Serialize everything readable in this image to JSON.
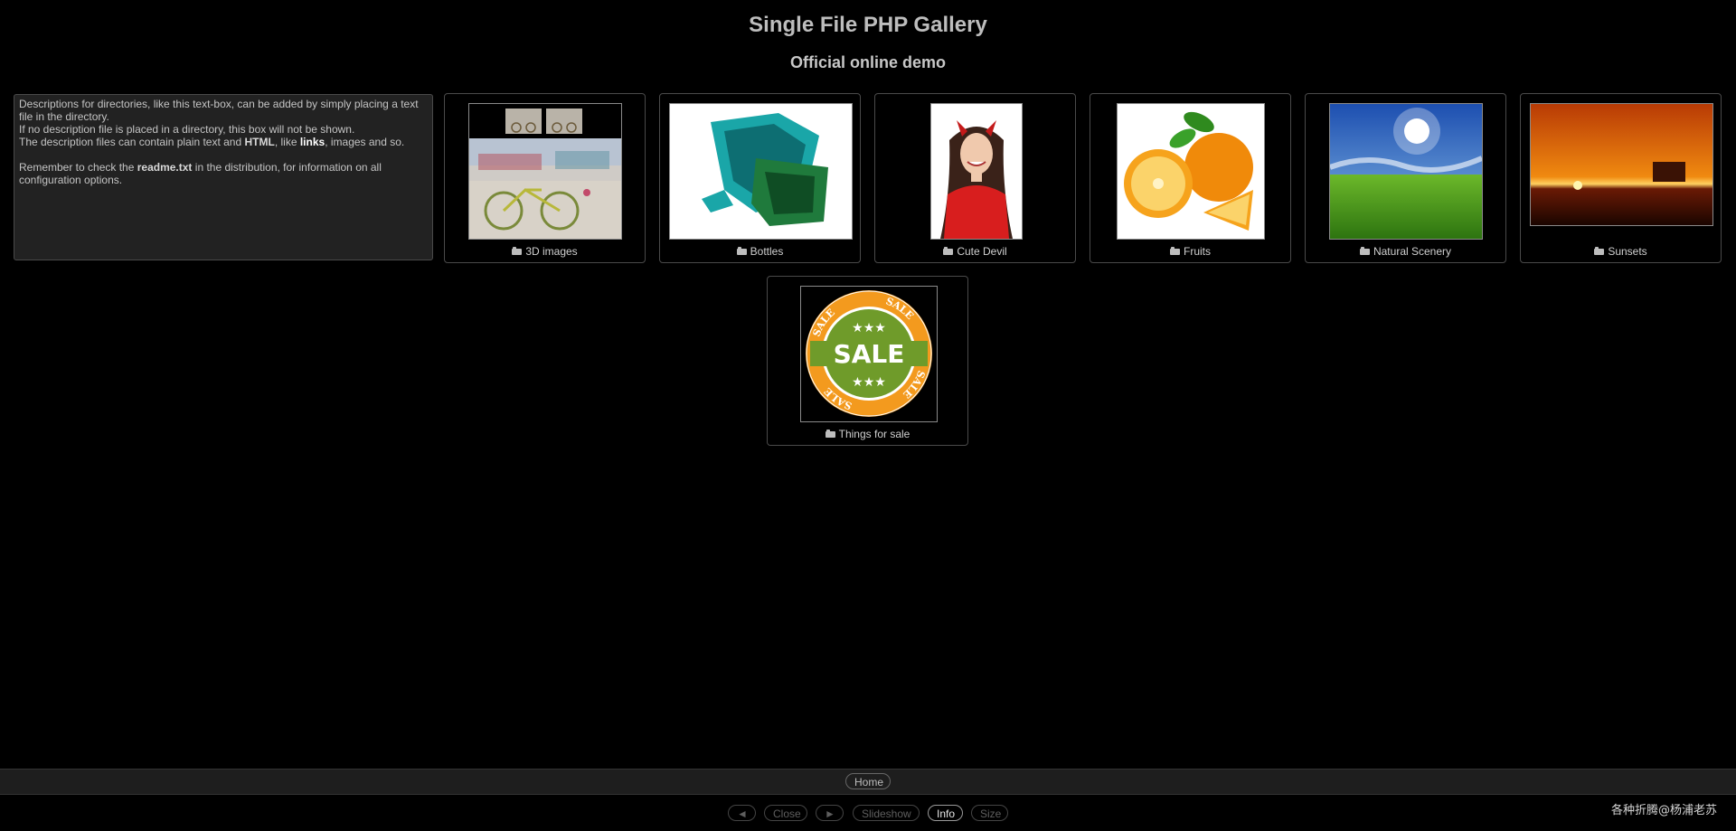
{
  "header": {
    "title": "Single File PHP Gallery",
    "subtitle": "Official online demo"
  },
  "description": {
    "line1": "Descriptions for directories, like this text-box, can be added by simply placing a text file in the directory.",
    "line2": "If no description file is placed in a directory, this box will not be shown.",
    "line3_pre": "The description files can contain plain text and ",
    "line3_bold": "HTML",
    "line3_mid": ", like ",
    "line3_link": "links",
    "line3_post": ", images and so.",
    "line4_pre": "Remember to check the ",
    "line4_bold": "readme.txt",
    "line4_post": " in the distribution, for information on all configuration options."
  },
  "folders": [
    {
      "label": "3D images",
      "icon": "folder-icon"
    },
    {
      "label": "Bottles",
      "icon": "folder-icon"
    },
    {
      "label": "Cute Devil",
      "icon": "folder-icon"
    },
    {
      "label": "Fruits",
      "icon": "folder-icon"
    },
    {
      "label": "Natural Scenery",
      "icon": "folder-icon"
    },
    {
      "label": "Sunsets",
      "icon": "folder-icon"
    },
    {
      "label": "Things for sale",
      "icon": "folder-icon"
    }
  ],
  "sale_badge": {
    "text": "SALE",
    "ring_text": "SALE"
  },
  "navbar": {
    "home": "Home"
  },
  "controls": {
    "prev": "◄",
    "close": "Close",
    "next": "►",
    "slideshow": "Slideshow",
    "info": "Info",
    "size": "Size"
  },
  "watermark": "各种折腾@杨浦老苏",
  "colors": {
    "background": "#000000",
    "panel": "#222222",
    "border": "#4a4a4a"
  }
}
